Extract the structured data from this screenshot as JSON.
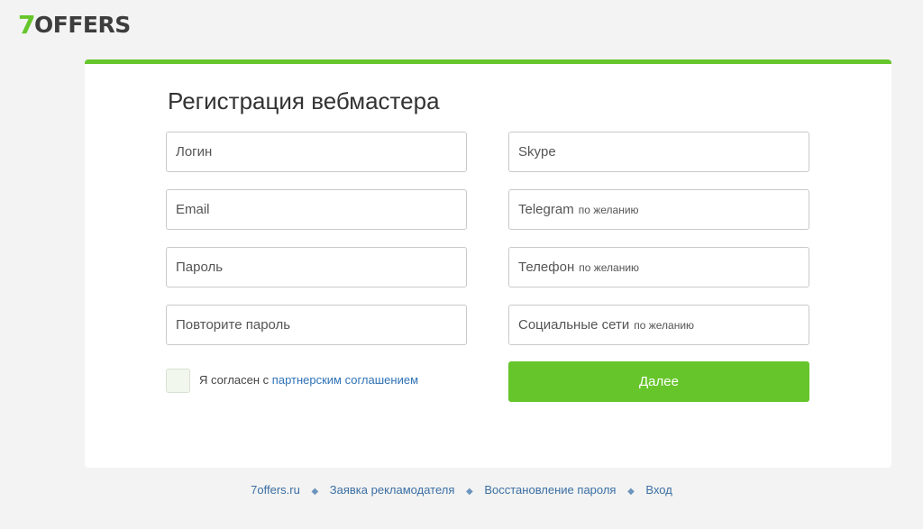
{
  "brand": {
    "logo_seven": "7",
    "logo_text": "OFFERS"
  },
  "page_title": "Регистрация вебмастера",
  "left_fields": [
    {
      "placeholder": "Логин"
    },
    {
      "placeholder": "Email"
    },
    {
      "placeholder": "Пароль"
    },
    {
      "placeholder": "Повторите пароль"
    }
  ],
  "right_fields": [
    {
      "placeholder": "Skype",
      "optional": ""
    },
    {
      "placeholder": "Telegram",
      "optional": "по желанию"
    },
    {
      "placeholder": "Телефон",
      "optional": "по желанию"
    },
    {
      "placeholder": "Социальные сети",
      "optional": "по желанию"
    }
  ],
  "agreement": {
    "prefix": "Я согласен с",
    "link": "партнерским соглашением",
    "checked": false
  },
  "submit_label": "Далее",
  "footer_links": [
    "7offers.ru",
    "Заявка рекламодателя",
    "Восстановление пароля",
    "Вход"
  ],
  "footer_separator": "◆",
  "colors": {
    "accent": "#66c52b",
    "link": "#2f72b6",
    "background": "#f2f3f2"
  }
}
